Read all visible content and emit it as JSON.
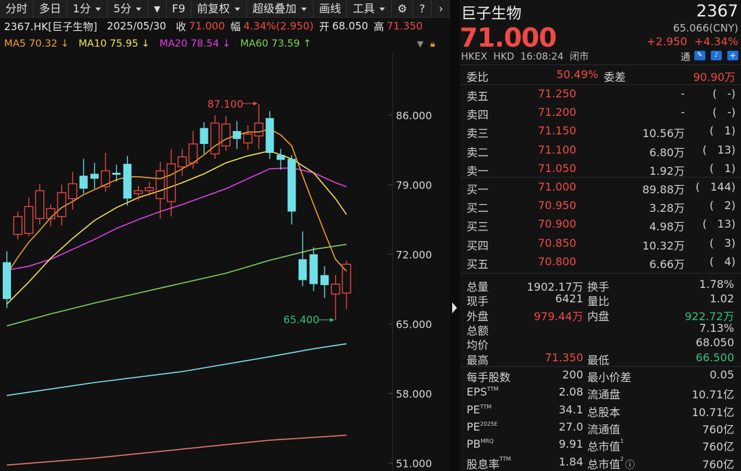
{
  "toolbar": {
    "items": [
      "分时",
      "多日",
      "1分",
      "5分",
      "▼",
      "F9",
      "前复权",
      "超级叠加",
      "画线",
      "工具"
    ],
    "gear": "⚙",
    "help": "?",
    "more": "›"
  },
  "info": {
    "code_name": "2367.HK[巨子生物]",
    "date": "2025/05/30",
    "close_label": "收",
    "close": "71.000",
    "chg_label": "幅",
    "chg": "4.34%(2.950)",
    "open_label": "开",
    "open": "68.050",
    "high_label": "高",
    "high": "71.350"
  },
  "ma": [
    {
      "label": "MA5",
      "value": "70.32",
      "dir": "↓",
      "color": "#f0a030"
    },
    {
      "label": "MA10",
      "value": "75.95",
      "dir": "↓",
      "color": "#f2e35a"
    },
    {
      "label": "MA20",
      "value": "78.54",
      "dir": "↓",
      "color": "#e040e8"
    },
    {
      "label": "MA60",
      "value": "73.59",
      "dir": "↑",
      "color": "#7fd25a"
    }
  ],
  "chart_data": {
    "type": "candlestick",
    "y_ticks": [
      "86.000",
      "79.000",
      "72.000",
      "65.000",
      "58.000",
      "51.000"
    ],
    "y_values": [
      86,
      79,
      72,
      65,
      58,
      51
    ],
    "ylim": [
      50.2,
      92.2
    ],
    "annotations": [
      {
        "text": "87.100",
        "value": 87.1
      },
      {
        "text": "65.400",
        "value": 65.4
      }
    ],
    "candles": [
      {
        "o": 71.2,
        "c": 67.5,
        "h": 72.3,
        "l": 66.6
      },
      {
        "o": 74.0,
        "c": 75.8,
        "h": 76.3,
        "l": 73.5
      },
      {
        "o": 74.1,
        "c": 76.8,
        "h": 77.7,
        "l": 73.8
      },
      {
        "o": 75.6,
        "c": 78.4,
        "h": 79.1,
        "l": 75.0
      },
      {
        "o": 75.6,
        "c": 76.6,
        "h": 77.0,
        "l": 74.8
      },
      {
        "o": 75.8,
        "c": 78.2,
        "h": 79.0,
        "l": 74.9
      },
      {
        "o": 77.6,
        "c": 79.1,
        "h": 80.3,
        "l": 76.5
      },
      {
        "o": 79.9,
        "c": 78.6,
        "h": 81.6,
        "l": 78.1
      },
      {
        "o": 80.1,
        "c": 79.6,
        "h": 81.2,
        "l": 78.6
      },
      {
        "o": 78.8,
        "c": 80.4,
        "h": 82.2,
        "l": 78.3
      },
      {
        "o": 80.2,
        "c": 80.0,
        "h": 81.0,
        "l": 79.3
      },
      {
        "o": 81.1,
        "c": 77.6,
        "h": 81.9,
        "l": 76.9
      },
      {
        "o": 78.1,
        "c": 78.4,
        "h": 78.9,
        "l": 77.4
      },
      {
        "o": 78.4,
        "c": 78.7,
        "h": 79.3,
        "l": 77.9
      },
      {
        "o": 77.6,
        "c": 80.4,
        "h": 81.3,
        "l": 75.6
      },
      {
        "o": 77.3,
        "c": 81.1,
        "h": 82.6,
        "l": 75.8
      },
      {
        "o": 80.8,
        "c": 81.8,
        "h": 82.6,
        "l": 79.9
      },
      {
        "o": 81.2,
        "c": 83.1,
        "h": 84.4,
        "l": 80.6
      },
      {
        "o": 84.7,
        "c": 83.1,
        "h": 85.3,
        "l": 82.1
      },
      {
        "o": 82.1,
        "c": 85.2,
        "h": 86.0,
        "l": 81.6
      },
      {
        "o": 82.9,
        "c": 85.1,
        "h": 85.9,
        "l": 82.4
      },
      {
        "o": 84.4,
        "c": 83.6,
        "h": 85.4,
        "l": 82.6
      },
      {
        "o": 83.2,
        "c": 84.1,
        "h": 85.0,
        "l": 82.5
      },
      {
        "o": 83.9,
        "c": 85.2,
        "h": 87.1,
        "l": 82.6
      },
      {
        "o": 85.7,
        "c": 82.2,
        "h": 86.4,
        "l": 81.6
      },
      {
        "o": 82.0,
        "c": 81.5,
        "h": 82.6,
        "l": 80.5
      },
      {
        "o": 81.6,
        "c": 76.3,
        "h": 82.0,
        "l": 75.0
      },
      {
        "o": 71.5,
        "c": 69.4,
        "h": 74.3,
        "l": 68.8
      },
      {
        "o": 72.0,
        "c": 69.0,
        "h": 72.7,
        "l": 68.3
      },
      {
        "o": 69.9,
        "c": 68.9,
        "h": 70.8,
        "l": 67.6
      },
      {
        "o": 68.0,
        "c": 69.0,
        "h": 69.9,
        "l": 65.4
      },
      {
        "o": 68.1,
        "c": 71.0,
        "h": 71.35,
        "l": 66.5
      }
    ],
    "ma5": [
      [
        0,
        70.0
      ],
      [
        1,
        71.7
      ],
      [
        2,
        73.2
      ],
      [
        3,
        74.4
      ],
      [
        4,
        75.7
      ],
      [
        5,
        76.7
      ],
      [
        6,
        77.3
      ],
      [
        7,
        78.0
      ],
      [
        8,
        78.5
      ],
      [
        9,
        79.0
      ],
      [
        10,
        79.5
      ],
      [
        11,
        79.8
      ],
      [
        12,
        79.8
      ],
      [
        13,
        79.7
      ],
      [
        14,
        79.6
      ],
      [
        15,
        80.0
      ],
      [
        16,
        80.6
      ],
      [
        17,
        81.2
      ],
      [
        18,
        82.0
      ],
      [
        19,
        82.9
      ],
      [
        20,
        83.6
      ],
      [
        21,
        84.0
      ],
      [
        22,
        84.3
      ],
      [
        23,
        84.3
      ],
      [
        24,
        84.6
      ],
      [
        25,
        84.0
      ],
      [
        26,
        82.9
      ],
      [
        27,
        79.9
      ],
      [
        28,
        77.0
      ],
      [
        29,
        74.2
      ],
      [
        30,
        71.5
      ],
      [
        31,
        70.3
      ]
    ],
    "ma10": [
      [
        0,
        67.0
      ],
      [
        2,
        69.2
      ],
      [
        4,
        71.6
      ],
      [
        6,
        73.6
      ],
      [
        8,
        75.4
      ],
      [
        10,
        76.7
      ],
      [
        12,
        77.7
      ],
      [
        14,
        78.4
      ],
      [
        16,
        79.2
      ],
      [
        18,
        80.1
      ],
      [
        20,
        81.2
      ],
      [
        22,
        81.9
      ],
      [
        24,
        82.4
      ],
      [
        26,
        81.6
      ],
      [
        28,
        80.2
      ],
      [
        30,
        77.6
      ],
      [
        31,
        76.0
      ]
    ],
    "ma20": [
      [
        0,
        70.4
      ],
      [
        2,
        70.8
      ],
      [
        4,
        71.5
      ],
      [
        6,
        72.5
      ],
      [
        8,
        73.5
      ],
      [
        10,
        74.6
      ],
      [
        12,
        75.5
      ],
      [
        14,
        76.3
      ],
      [
        16,
        77.0
      ],
      [
        18,
        77.8
      ],
      [
        20,
        78.6
      ],
      [
        22,
        79.6
      ],
      [
        24,
        80.6
      ],
      [
        26,
        80.7
      ],
      [
        28,
        80.2
      ],
      [
        30,
        79.2
      ],
      [
        31,
        78.8
      ]
    ],
    "ma60": [
      [
        0,
        64.8
      ],
      [
        4,
        66.0
      ],
      [
        8,
        67.1
      ],
      [
        12,
        68.1
      ],
      [
        16,
        69.1
      ],
      [
        20,
        70.1
      ],
      [
        24,
        71.4
      ],
      [
        28,
        72.5
      ],
      [
        31,
        73.0
      ]
    ],
    "ma120": [
      [
        0,
        57.8
      ],
      [
        8,
        59.1
      ],
      [
        16,
        60.2
      ],
      [
        24,
        61.7
      ],
      [
        28,
        62.5
      ],
      [
        31,
        63.0
      ]
    ],
    "ma250": [
      [
        0,
        50.8
      ],
      [
        8,
        51.5
      ],
      [
        16,
        52.4
      ],
      [
        24,
        53.3
      ],
      [
        31,
        53.8
      ]
    ]
  },
  "quote": {
    "name": "巨子生物",
    "code": "2367",
    "price": "71.000",
    "cny": "65.066(CNY)",
    "change": "+2.950",
    "change_pct": "+4.34%",
    "market": "HKEX",
    "currency": "HKD",
    "time": "16:08:24",
    "status": "闭市",
    "tong": "通"
  },
  "bidask": {
    "webi_label": "委比",
    "webi": "50.49%",
    "weicha_label": "委差",
    "weicha": "90.90万",
    "asks": [
      {
        "label": "卖五",
        "price": "71.250",
        "vol": "-",
        "count": "-"
      },
      {
        "label": "卖四",
        "price": "71.200",
        "vol": "-",
        "count": "-"
      },
      {
        "label": "卖三",
        "price": "71.150",
        "vol": "10.56万",
        "count": "1"
      },
      {
        "label": "卖二",
        "price": "71.100",
        "vol": "6.80万",
        "count": "13"
      },
      {
        "label": "卖一",
        "price": "71.050",
        "vol": "1.92万",
        "count": "1"
      }
    ],
    "bids": [
      {
        "label": "买一",
        "price": "71.000",
        "vol": "89.88万",
        "count": "144"
      },
      {
        "label": "买二",
        "price": "70.950",
        "vol": "3.28万",
        "count": "2"
      },
      {
        "label": "买三",
        "price": "70.900",
        "vol": "4.98万",
        "count": "13"
      },
      {
        "label": "买四",
        "price": "70.850",
        "vol": "10.32万",
        "count": "3"
      },
      {
        "label": "买五",
        "price": "70.800",
        "vol": "6.66万",
        "count": "4"
      }
    ]
  },
  "stats": [
    {
      "l1": "总量",
      "v1": "1902.17万",
      "l2": "换手",
      "v2": "1.78%"
    },
    {
      "l1": "现手",
      "v1": "6421",
      "l2": "量比",
      "v2": "1.02"
    },
    {
      "l1": "外盘",
      "v1": "979.44万",
      "l2": "内盘",
      "v2": "922.72万"
    },
    {
      "l1": "总额",
      "v1": "",
      "l2": "",
      "v2": "7.13%"
    },
    {
      "l1": "均价",
      "v1": "",
      "l2": "",
      "v2": "68.050"
    },
    {
      "l1": "最高",
      "v1": "71.350",
      "l2": "最低",
      "v2": "66.500"
    }
  ],
  "fund": [
    {
      "l1": "每手股数",
      "v1": "200",
      "l2": "最小价差",
      "v2": "0.05"
    },
    {
      "l1": "EPS",
      "s1": "TTM",
      "v1": "2.08",
      "l2": "流通盘",
      "v2": "10.71亿"
    },
    {
      "l1": "PE",
      "s1": "TTM",
      "v1": "34.1",
      "l2": "总股本",
      "v2": "10.71亿"
    },
    {
      "l1": "PE",
      "s1": "2025E",
      "v1": "27.0",
      "l2": "流通值",
      "v2": "760亿"
    },
    {
      "l1": "PB",
      "s1": "MRQ",
      "v1": "9.91",
      "l2": "总市值",
      "s2": "1",
      "v2": "760亿"
    },
    {
      "l1": "股息率",
      "s1": "TTM",
      "v1": "1.84",
      "l2": "总市值",
      "s2": "2",
      "v2": "760亿"
    }
  ]
}
